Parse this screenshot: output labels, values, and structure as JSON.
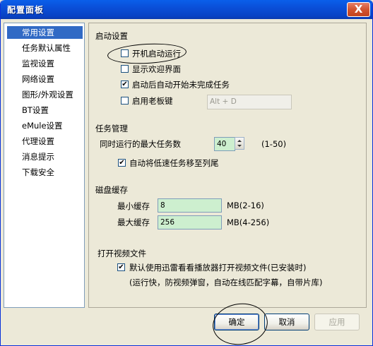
{
  "window": {
    "title": "配置面板",
    "close_label": "X"
  },
  "sidebar": {
    "items": [
      {
        "label": "常用设置",
        "selected": true
      },
      {
        "label": "任务默认属性",
        "selected": false
      },
      {
        "label": "监视设置",
        "selected": false
      },
      {
        "label": "网络设置",
        "selected": false
      },
      {
        "label": "图形/外观设置",
        "selected": false
      },
      {
        "label": "BT设置",
        "selected": false
      },
      {
        "label": "eMule设置",
        "selected": false
      },
      {
        "label": "代理设置",
        "selected": false
      },
      {
        "label": "消息提示",
        "selected": false
      },
      {
        "label": "下载安全",
        "selected": false
      }
    ]
  },
  "startup": {
    "title": "启动设置",
    "autostart": {
      "label": "开机启动运行",
      "checked": false
    },
    "welcome": {
      "label": "显示欢迎界面",
      "checked": false
    },
    "resume": {
      "label": "启动后自动开始未完成任务",
      "checked": true
    },
    "bosskey": {
      "label": "启用老板键",
      "checked": false,
      "value": "Alt + D"
    }
  },
  "tasks": {
    "title": "任务管理",
    "max_tasks": {
      "label": "同时运行的最大任务数",
      "value": "40",
      "range": "(1-50)"
    },
    "move_slow": {
      "label": "自动将低速任务移至列尾",
      "checked": true
    }
  },
  "cache": {
    "title": "磁盘缓存",
    "min": {
      "label": "最小缓存",
      "value": "8",
      "range": "MB(2-16)"
    },
    "max": {
      "label": "最大缓存",
      "value": "256",
      "range": "MB(4-256)"
    }
  },
  "video": {
    "title": "打开视频文件",
    "default_player": {
      "label": "默认使用迅雷看看播放器打开视频文件(已安装时)",
      "checked": true
    },
    "note": "(运行快，防视频弹窗，自动在线匹配字幕，自带片库)"
  },
  "buttons": {
    "ok": "确定",
    "cancel": "取消",
    "apply": "应用"
  },
  "marks": {
    "check": "✔"
  }
}
